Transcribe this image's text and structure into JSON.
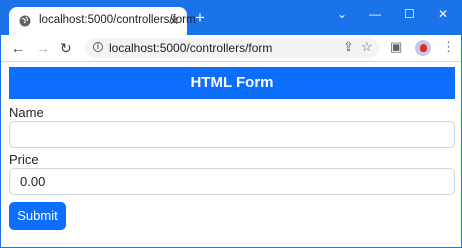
{
  "browser": {
    "tab": {
      "title": "localhost:5000/controllers/form",
      "close_label": "✕",
      "favicon_icon": "globe-icon"
    },
    "new_tab_label": "+",
    "window_controls": {
      "chevron": "⌄",
      "minimize": "—",
      "maximize": "☐",
      "close": "✕"
    },
    "nav": {
      "back": "←",
      "forward": "→",
      "reload": "↻"
    },
    "address_bar": {
      "url": "localhost:5000/controllers/form",
      "info_icon": "info-icon"
    },
    "toolbar_icons": {
      "share": "⇪",
      "star": "☆",
      "sidebar": "▣",
      "menu": "⋮"
    },
    "accent_color": "#1a73e8"
  },
  "page": {
    "header": "HTML Form",
    "header_color": "#0d6efd",
    "fields": [
      {
        "label": "Name",
        "value": ""
      },
      {
        "label": "Price",
        "value": "0.00"
      }
    ],
    "submit_label": "Submit"
  }
}
